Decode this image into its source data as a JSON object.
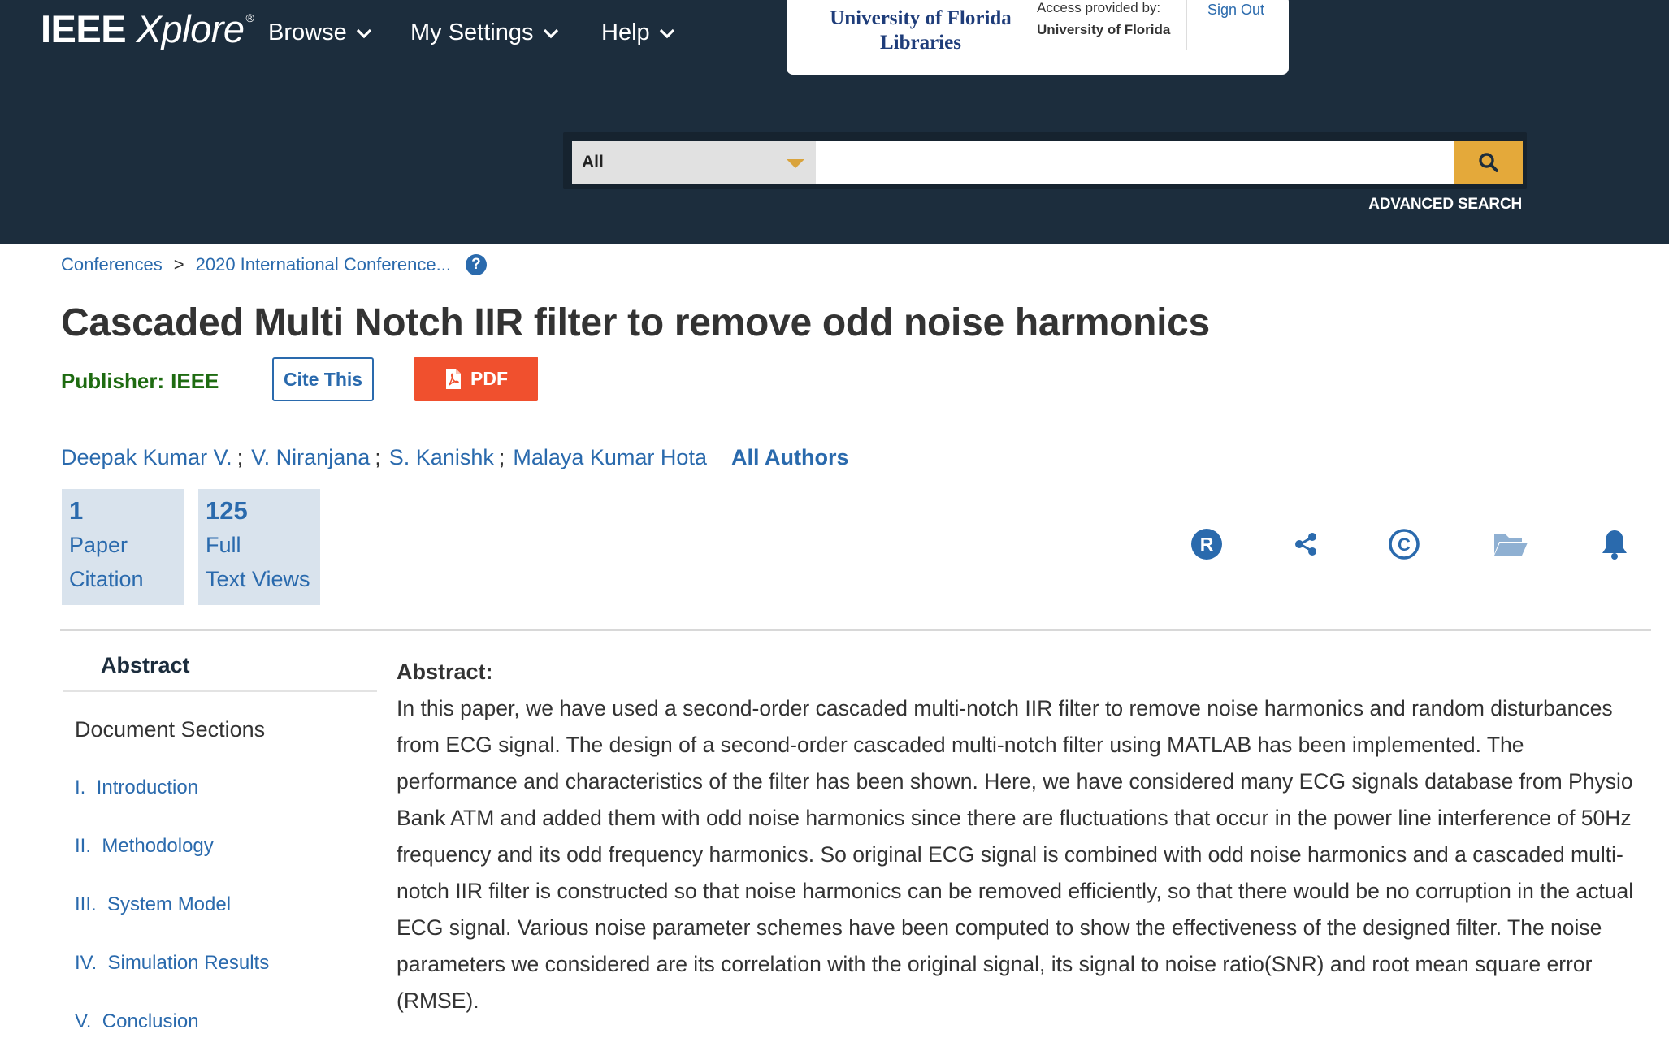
{
  "header": {
    "logo_ieee": "IEEE",
    "logo_xplore": "Xplore",
    "logo_reg": "®",
    "nav": [
      {
        "label": "Browse"
      },
      {
        "label": "My Settings"
      },
      {
        "label": "Help"
      }
    ],
    "institution": {
      "logo_line1": "University of Florida",
      "logo_line2": "Libraries",
      "access_label": "Access provided by:",
      "access_name": "University of Florida",
      "sign_out": "Sign Out"
    },
    "search": {
      "scope": "All",
      "placeholder": "",
      "advanced": "ADVANCED SEARCH"
    }
  },
  "breadcrumb": {
    "items": [
      "Conferences",
      "2020 International Conference..."
    ],
    "separator": ">",
    "help": "?"
  },
  "paper": {
    "title": "Cascaded Multi Notch IIR filter to remove odd noise harmonics",
    "publisher_label": "Publisher:",
    "publisher_value": "IEEE",
    "cite_label": "Cite This",
    "pdf_label": "PDF",
    "authors": [
      "Deepak Kumar V.",
      "V. Niranjana",
      "S. Kanishk",
      "Malaya Kumar Hota"
    ],
    "author_sep": ";",
    "all_authors": "All Authors"
  },
  "metrics": [
    {
      "value": "1",
      "line1": "Paper",
      "line2": "Citation"
    },
    {
      "value": "125",
      "line1": "Full",
      "line2": "Text Views"
    }
  ],
  "actions": {
    "icons": [
      "rights-icon",
      "share-icon",
      "copyright-icon",
      "folder-icon",
      "bell-icon"
    ],
    "rights_letter": "R",
    "copyright_letter": "C"
  },
  "sidebar": {
    "tab": "Abstract",
    "heading": "Document Sections",
    "sections": [
      "I.  Introduction",
      "II.  Methodology",
      "III.  System Model",
      "IV.  Simulation Results",
      "V.  Conclusion"
    ]
  },
  "abstract": {
    "label": "Abstract:",
    "text": "In this paper, we have used a second-order cascaded multi-notch IIR filter to remove noise harmonics and random disturbances from ECG signal. The design of a second-order cascaded multi-notch filter using MATLAB has been implemented. The performance and characteristics of the filter has been shown. Here, we have considered many ECG signals database from Physio Bank ATM and added them with odd noise harmonics since there are fluctuations that occur in the power line interference of 50Hz frequency and its odd frequency harmonics. So original ECG signal is combined with odd noise harmonics and a cascaded multi-notch IIR filter is constructed so that noise harmonics can be removed efficiently, so that there would be no corruption in the actual ECG signal. Various noise parameter schemes have been computed to show the effectiveness of the designed filter. The noise parameters we considered are its correlation with the original signal, its signal to noise ratio(SNR) and root mean square error (RMSE)."
  },
  "colors": {
    "header_bg": "#1c2d3d",
    "link": "#2a6aad",
    "publisher_green": "#1e6b11",
    "pdf_orange": "#f0502e",
    "search_gold": "#e4a93a",
    "metric_bg": "#d9e3ed"
  }
}
